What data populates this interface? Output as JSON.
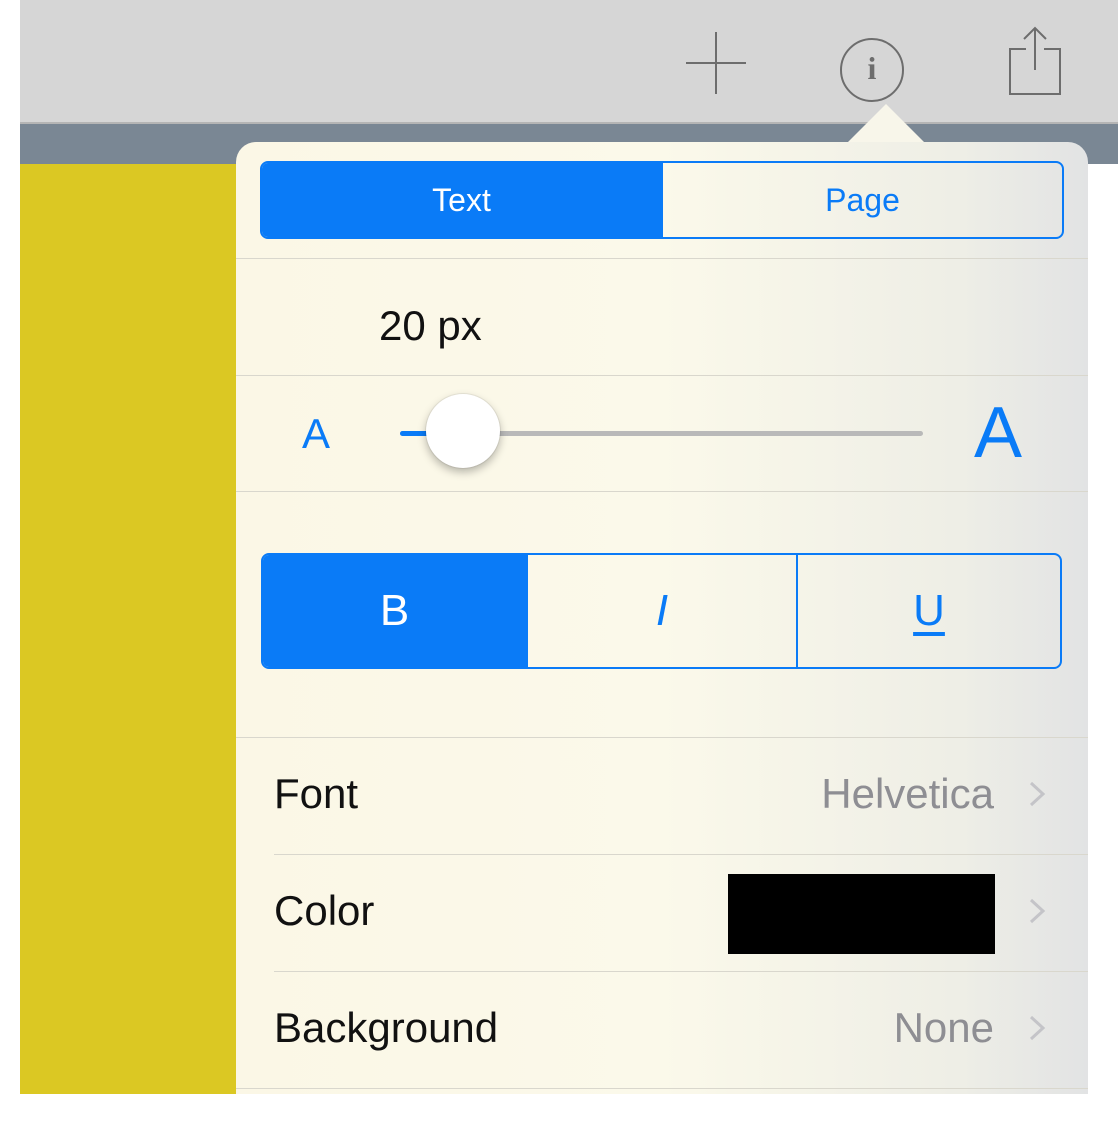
{
  "colors": {
    "accent": "#0a7bf7",
    "toolbar_bg": "#d6d6d6",
    "document_bg": "#dbc823",
    "document_strip": "#7a8794",
    "color_swatch": "#000000"
  },
  "toolbar": {
    "icons": [
      "add-icon",
      "info-icon",
      "share-icon"
    ],
    "info_glyph": "i"
  },
  "inspector": {
    "tabs": [
      {
        "label": "Text",
        "selected": true
      },
      {
        "label": "Page",
        "selected": false
      }
    ],
    "font_size": {
      "label": "20 px",
      "min_glyph": "A",
      "max_glyph": "A",
      "slider_fraction": 0.12
    },
    "styles": [
      {
        "label": "B",
        "name": "bold",
        "selected": true
      },
      {
        "label": "I",
        "name": "italic",
        "selected": false
      },
      {
        "label": "U",
        "name": "underline",
        "selected": false
      }
    ],
    "rows": [
      {
        "label": "Font",
        "value": "Helvetica"
      },
      {
        "label": "Color",
        "value": ""
      },
      {
        "label": "Background",
        "value": "None"
      }
    ]
  }
}
